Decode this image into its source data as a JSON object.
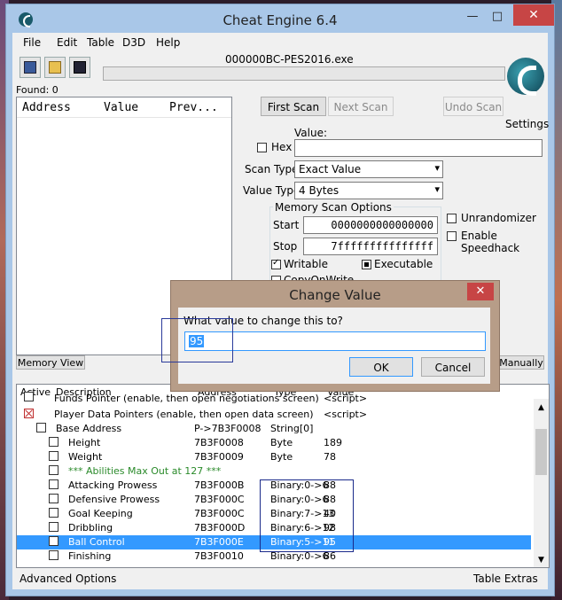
{
  "window": {
    "title": "Cheat Engine 6.4",
    "minimize": "—",
    "maximize": "□",
    "close": "✕"
  },
  "menu": [
    "File",
    "Edit",
    "Table",
    "D3D",
    "Help"
  ],
  "process_name": "000000BC-PES2016.exe",
  "found": "Found: 0",
  "settings_label": "Settings",
  "results_columns": [
    "Address",
    "Value",
    "Prev..."
  ],
  "scan": {
    "first_scan": "First Scan",
    "next_scan": "Next Scan",
    "undo_scan": "Undo Scan",
    "value_label": "Value:",
    "hex_label": "Hex",
    "scan_type_label": "Scan Type",
    "scan_type_value": "Exact Value",
    "value_type_label": "Value Type",
    "value_type_value": "4 Bytes",
    "memory_options_label": "Memory Scan Options",
    "start_label": "Start",
    "start_value": "0000000000000000",
    "stop_label": "Stop",
    "stop_value": "7fffffffffffffff",
    "writable_label": "Writable",
    "executable_label": "Executable",
    "copyonwrite_label": "CopyOnWrite",
    "unrandomizer_label": "Unrandomizer",
    "speedhack_label": "Enable Speedhack"
  },
  "memory_view_button": "Memory View",
  "manually_button": "Manually",
  "table": {
    "columns": [
      "Active",
      "Description",
      "Address",
      "Type",
      "Value"
    ],
    "rows": [
      {
        "description": "Funds Pointer (enable, then open negotiations screen)",
        "address": "",
        "type": "",
        "value": "<script>"
      },
      {
        "description": "Player Data Pointers (enable, then open data screen)",
        "address": "",
        "type": "",
        "value": "<script>"
      },
      {
        "description": "Base Address",
        "address": "P->7B3F0008",
        "type": "String[0]",
        "value": ""
      },
      {
        "description": "Height",
        "address": "7B3F0008",
        "type": "Byte",
        "value": "189"
      },
      {
        "description": "Weight",
        "address": "7B3F0009",
        "type": "Byte",
        "value": "78"
      },
      {
        "description": "*** Abilities Max Out at 127 ***",
        "address": "",
        "type": "",
        "value": ""
      },
      {
        "description": "Attacking Prowess",
        "address": "7B3F000B",
        "type": "Binary:0->6",
        "value": "88"
      },
      {
        "description": "Defensive Prowess",
        "address": "7B3F000C",
        "type": "Binary:0->6",
        "value": "88"
      },
      {
        "description": "Goal Keeping",
        "address": "7B3F000C",
        "type": "Binary:7->13",
        "value": "40"
      },
      {
        "description": "Dribbling",
        "address": "7B3F000D",
        "type": "Binary:6->12",
        "value": "98"
      },
      {
        "description": "Ball Control",
        "address": "7B3F000E",
        "type": "Binary:5->11",
        "value": "95"
      },
      {
        "description": "Finishing",
        "address": "7B3F0010",
        "type": "Binary:0->6",
        "value": "86"
      }
    ]
  },
  "status": {
    "advanced_options": "Advanced Options",
    "table_extras": "Table Extras"
  },
  "dialog": {
    "title": "Change Value",
    "close": "✕",
    "prompt": "What value to change this to?",
    "input_value": "95",
    "ok": "OK",
    "cancel": "Cancel"
  }
}
